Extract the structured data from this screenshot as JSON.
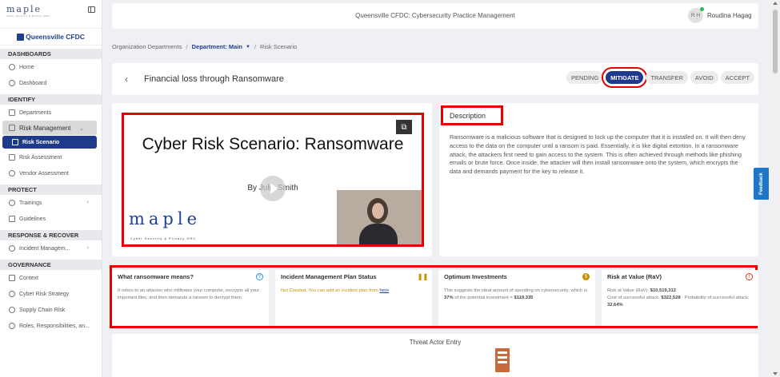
{
  "app": {
    "logo": "maple",
    "logo_sub": "Cyber Security & Privacy GRC",
    "org": "Queensville CFDC"
  },
  "sidebar": {
    "sections": [
      {
        "title": "DASHBOARDS",
        "items": [
          {
            "label": "Home"
          },
          {
            "label": "Dashboard"
          }
        ]
      },
      {
        "title": "IDENTIFY",
        "items": [
          {
            "label": "Departments"
          },
          {
            "label": "Risk Management"
          },
          {
            "label": "Risk Scenario"
          },
          {
            "label": "Risk Assessment"
          },
          {
            "label": "Vendor Assessment"
          }
        ]
      },
      {
        "title": "PROTECT",
        "items": [
          {
            "label": "Trainings"
          },
          {
            "label": "Guidelines"
          }
        ]
      },
      {
        "title": "RESPONSE & RECOVER",
        "items": [
          {
            "label": "Incident Managem..."
          }
        ]
      },
      {
        "title": "GOVERNANCE",
        "items": [
          {
            "label": "Context"
          },
          {
            "label": "Cyber Risk Strategy"
          },
          {
            "label": "Supply Chain Risk"
          },
          {
            "label": "Roles, Responsibilities, an..."
          }
        ]
      }
    ]
  },
  "header": {
    "title": "Queensville CFDC: Cybersecurity Practice Management",
    "user_initials": "R H",
    "user_name": "Roudina Hagag"
  },
  "breadcrumb": {
    "root": "Organization Departments",
    "dept": "Department: Main",
    "current": "Risk Scenario"
  },
  "page": {
    "title": "Financial loss through Ransomware"
  },
  "status_buttons": [
    "PENDING",
    "MITIGATE",
    "TRANSFER",
    "AVOID",
    "ACCEPT"
  ],
  "video": {
    "slide_title": "Cyber Risk Scenario: Ransomware",
    "slide_author": "By Julia Smith",
    "logo": "maple",
    "logo_sub": "Cyber Security & Privacy GRC"
  },
  "description": {
    "title": "Description",
    "text": "Ransomware is a malicious software that is designed to lock up the computer that it is installed on. It will then deny access to the data on the computer until a ransom is paid. Essentially, it is like digital extortion. In a ransomware attack, the attackers first need to gain access to the system. This is often achieved through methods like phishing emails or brute force. Once inside, the attacker will then install ransomware onto the system, which encrypts the data and demands payment for the key to release it."
  },
  "metrics": {
    "ransomware": {
      "title": "What ransomware means?",
      "text": "It refers to an attacker who infiltrates your computer, encrypts all your important files, and then demands a ransom to decrypt them."
    },
    "incident": {
      "title": "Incident Management Plan Status",
      "text": "Not Created. You can add an incident plan from",
      "link": "here"
    },
    "investments": {
      "title": "Optimum Investments",
      "text_a": "This suggests the ideal amount of spending on cybersecurity, which is",
      "pct": "37%",
      "text_b": "of the potential investment =",
      "amount": "$119,335"
    },
    "rav": {
      "title": "Risk at Value (RaV)",
      "line1_label": "Risk at Value (RaV):",
      "line1_value": "$10,519,312",
      "line2_label": "Cost of successful attack:",
      "line2_value": "$322,528",
      "line2b_label": "Probability of successful attack:",
      "line2b_value": "32.64%"
    }
  },
  "threat": {
    "title": "Threat Actor Entry"
  },
  "feedback": "Feedback"
}
